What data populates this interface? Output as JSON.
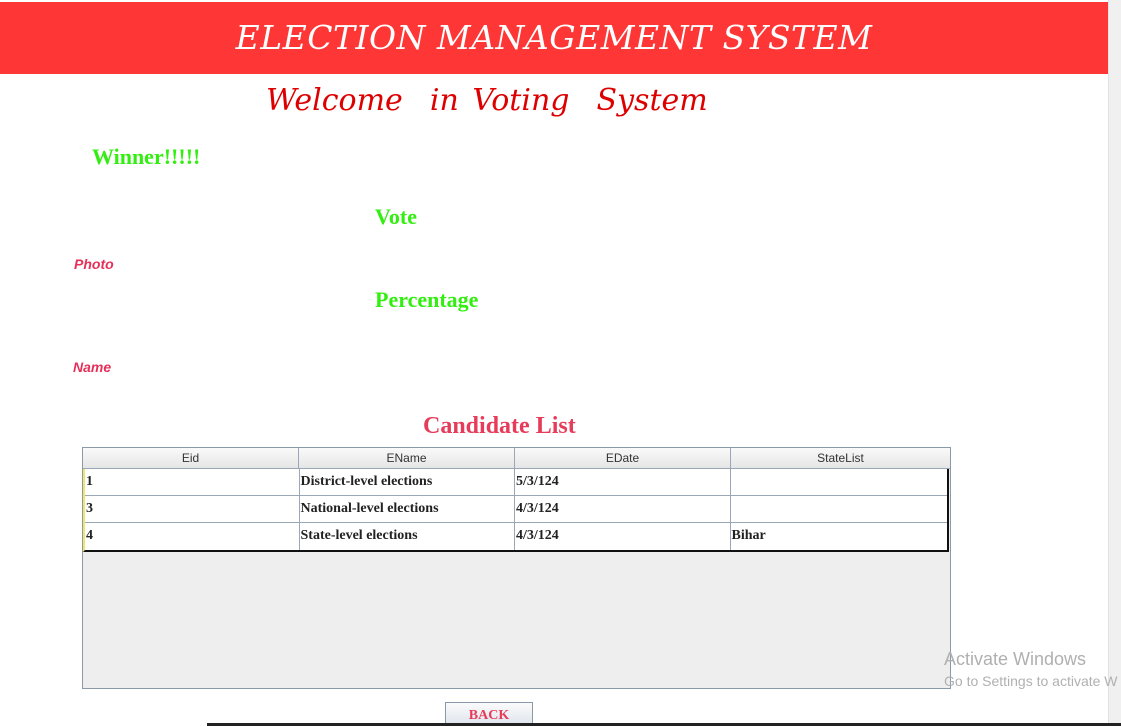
{
  "header": {
    "title": "ELECTION MANAGEMENT SYSTEM",
    "color": "#ff3636"
  },
  "welcome_text": "Welcome  in Voting  System",
  "winner_text": "Winner!!!!!",
  "labels": {
    "vote": "Vote",
    "percentage": "Percentage",
    "photo": "Photo",
    "name": "Name"
  },
  "candidate_list": {
    "title": "Candidate List",
    "columns": [
      "Eid",
      "EName",
      "EDate",
      "StateList"
    ],
    "rows": [
      [
        "1",
        "District-level elections",
        "5/3/124",
        ""
      ],
      [
        "3",
        "National-level elections",
        "4/3/124",
        ""
      ],
      [
        "4",
        "State-level elections",
        "4/3/124",
        "Bihar"
      ]
    ]
  },
  "back_button": "BACK",
  "windows_watermark": {
    "title": "Activate Windows",
    "subtitle": "Go to Settings to activate W"
  }
}
